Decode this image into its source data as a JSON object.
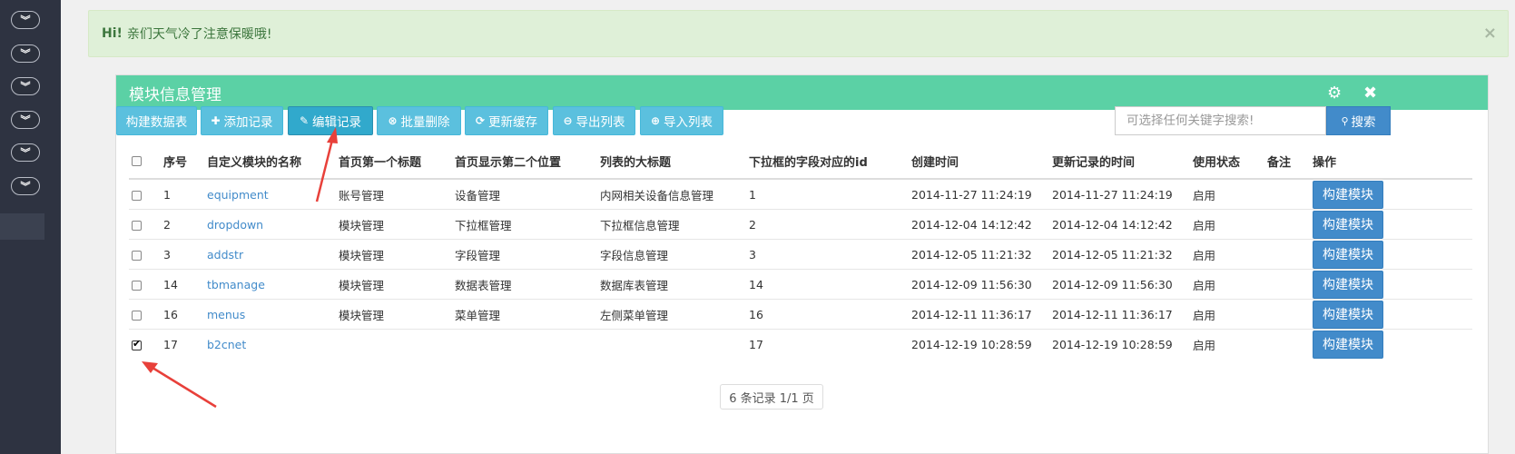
{
  "alert": {
    "greeting": "Hi!",
    "message": "亲们天气冷了注意保暖哦!",
    "close": "×"
  },
  "panel": {
    "title": "模块信息管理",
    "settings_icon": "⚙",
    "close_icon": "✖"
  },
  "toolbar": [
    {
      "icon": "",
      "label": "构建数据表"
    },
    {
      "icon": "✚",
      "label": "添加记录"
    },
    {
      "icon": "✎",
      "label": "编辑记录"
    },
    {
      "icon": "⊗",
      "label": "批量删除"
    },
    {
      "icon": "⟳",
      "label": "更新缓存"
    },
    {
      "icon": "⊖",
      "label": "导出列表"
    },
    {
      "icon": "⊕",
      "label": "导入列表"
    }
  ],
  "search": {
    "placeholder": "可选择任何关键字搜索!",
    "button_icon": "🔍",
    "button_label": "搜索"
  },
  "table": {
    "headers": [
      "序号",
      "自定义模块的名称",
      "首页第一个标题",
      "首页显示第二个位置",
      "列表的大标题",
      "下拉框的字段对应的id",
      "创建时间",
      "更新记录的时间",
      "使用状态",
      "备注",
      "操作"
    ],
    "rows": [
      {
        "checked": false,
        "id": "1",
        "name": "equipment",
        "title1": "账号管理",
        "title2": "设备管理",
        "list_title": "内网相关设备信息管理",
        "dropdown_id": "1",
        "created": "2014-11-27 11:24:19",
        "updated": "2014-11-27 11:24:19",
        "status": "启用",
        "note": "",
        "action": "构建模块"
      },
      {
        "checked": false,
        "id": "2",
        "name": "dropdown",
        "title1": "模块管理",
        "title2": "下拉框管理",
        "list_title": "下拉框信息管理",
        "dropdown_id": "2",
        "created": "2014-12-04 14:12:42",
        "updated": "2014-12-04 14:12:42",
        "status": "启用",
        "note": "",
        "action": "构建模块"
      },
      {
        "checked": false,
        "id": "3",
        "name": "addstr",
        "title1": "模块管理",
        "title2": "字段管理",
        "list_title": "字段信息管理",
        "dropdown_id": "3",
        "created": "2014-12-05 11:21:32",
        "updated": "2014-12-05 11:21:32",
        "status": "启用",
        "note": "",
        "action": "构建模块"
      },
      {
        "checked": false,
        "id": "14",
        "name": "tbmanage",
        "title1": "模块管理",
        "title2": "数据表管理",
        "list_title": "数据库表管理",
        "dropdown_id": "14",
        "created": "2014-12-09 11:56:30",
        "updated": "2014-12-09 11:56:30",
        "status": "启用",
        "note": "",
        "action": "构建模块"
      },
      {
        "checked": false,
        "id": "16",
        "name": "menus",
        "title1": "模块管理",
        "title2": "菜单管理",
        "list_title": "左侧菜单管理",
        "dropdown_id": "16",
        "created": "2014-12-11 11:36:17",
        "updated": "2014-12-11 11:36:17",
        "status": "启用",
        "note": "",
        "action": "构建模块"
      },
      {
        "checked": true,
        "id": "17",
        "name": "b2cnet",
        "title1": "",
        "title2": "",
        "list_title": "",
        "dropdown_id": "17",
        "created": "2014-12-19 10:28:59",
        "updated": "2014-12-19 10:28:59",
        "status": "启用",
        "note": "",
        "action": "构建模块"
      }
    ]
  },
  "pagination": "6 条记录 1/1 页",
  "sidebar": {
    "toggle_icon": "»",
    "toggle_count": 6
  },
  "colors": {
    "panel_header": "#5bd1a5",
    "toolbar_button": "#5bc0de",
    "primary": "#428bca",
    "alert_bg": "#dff0d8",
    "annotation_arrow": "#e8403a"
  }
}
